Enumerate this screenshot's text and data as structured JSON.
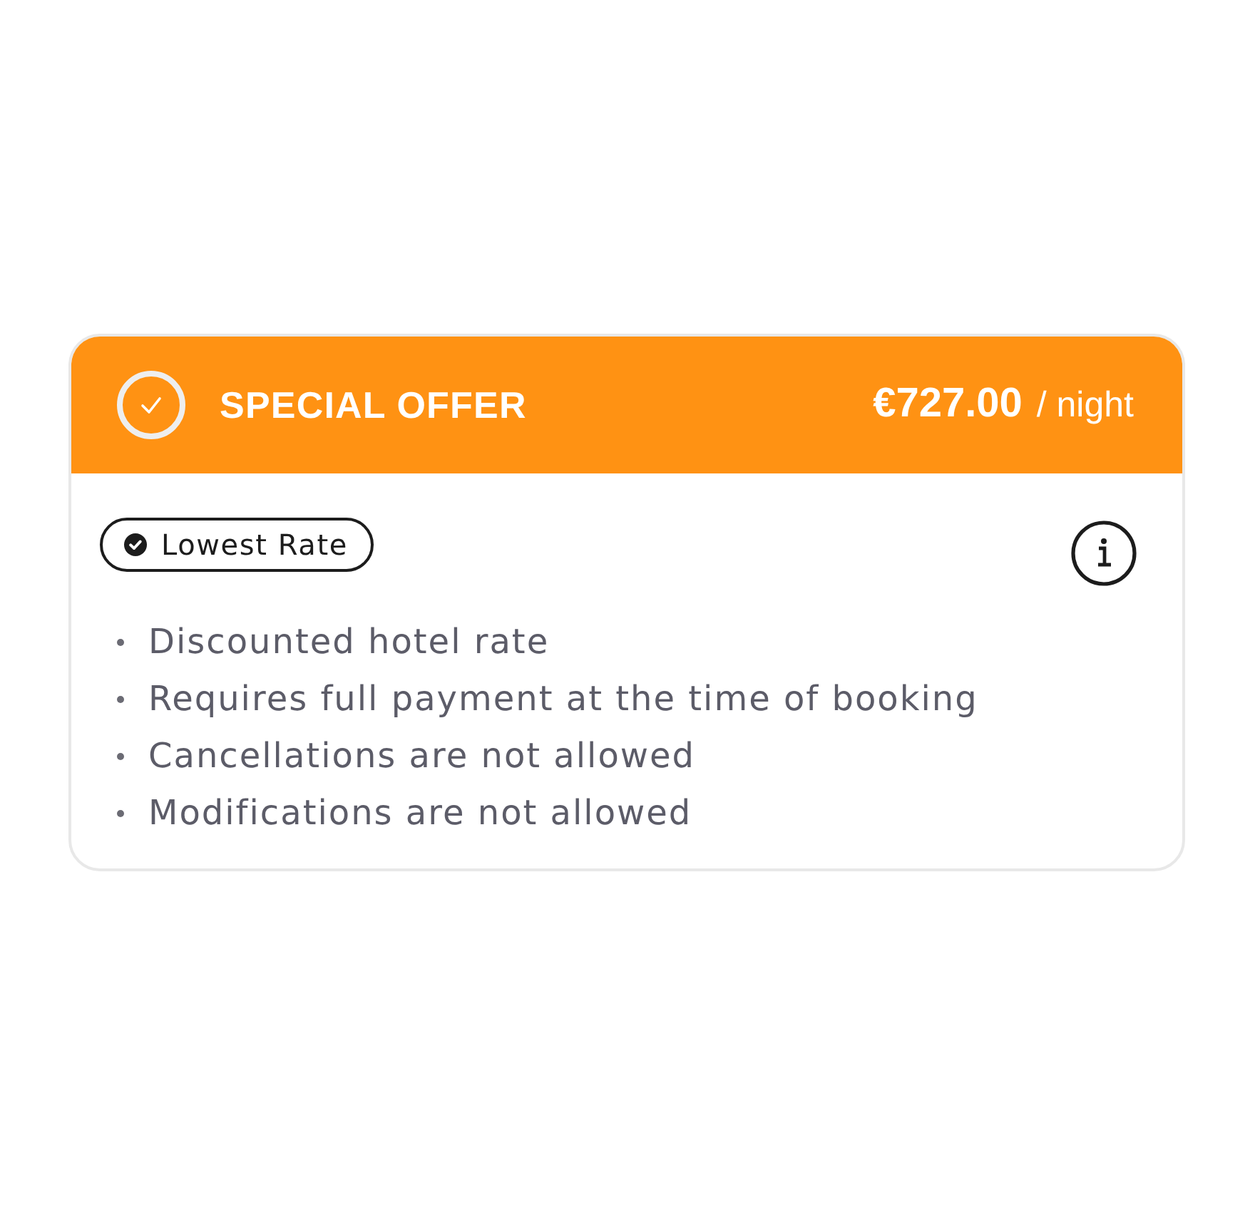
{
  "offer": {
    "title": "SPECIAL OFFER",
    "price": "€727.00",
    "price_unit": "/ night"
  },
  "badge": {
    "label": "Lowest Rate"
  },
  "features": [
    "Discounted hotel rate",
    "Requires full payment at the time of booking",
    "Cancellations are not allowed",
    "Modifications are not allowed"
  ]
}
